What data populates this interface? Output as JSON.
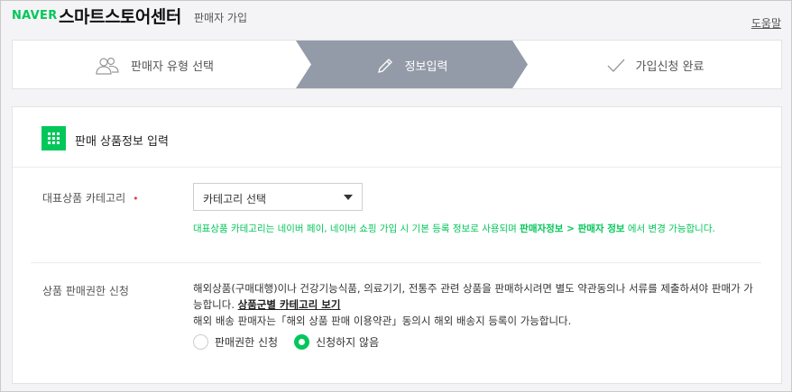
{
  "header": {
    "naver": "NAVER",
    "title": "스마트스토어센터",
    "subtitle": "판매자 가입",
    "help": "도움말"
  },
  "steps": [
    {
      "label": "판매자 유형 선택",
      "icon": "people-icon",
      "active": false
    },
    {
      "label": "정보입력",
      "icon": "pencil-icon",
      "active": true
    },
    {
      "label": "가입신청 완료",
      "icon": "checkmark-icon",
      "active": false
    }
  ],
  "colors": {
    "accent": "#03c75a",
    "active_step": "#949ba8",
    "required": "#e83a3a"
  },
  "section": {
    "icon": "grid-icon",
    "title": "판매 상품정보 입력"
  },
  "category": {
    "label": "대표상품 카테고리",
    "required_mark": "•",
    "select_value": "카테고리 선택",
    "help_part1": "대표상품 카테고리는 네이버 페이, 네이버 쇼핑 가입 시 기본 등록 정보로 사용되며 ",
    "help_bold": "판매자정보 > 판매자 정보",
    "help_part2": " 에서 변경 가능합니다."
  },
  "permission": {
    "label": "상품 판매권한 신청",
    "desc1": "해외상품(구매대행)이나 건강기능식품, 의료기기, 전통주 관련 상품을 판매하시려면 별도 약관동의나 서류를 제출하셔야 판매가 가능합니다. ",
    "desc1_link": "상품군별 카테고리 보기",
    "desc2": "해외 배송 판매자는「해외 상품 판매 이용약관」동의시 해외 배송지 등록이 가능합니다.",
    "options": [
      {
        "label": "판매권한 신청",
        "selected": false
      },
      {
        "label": "신청하지 않음",
        "selected": true
      }
    ]
  }
}
